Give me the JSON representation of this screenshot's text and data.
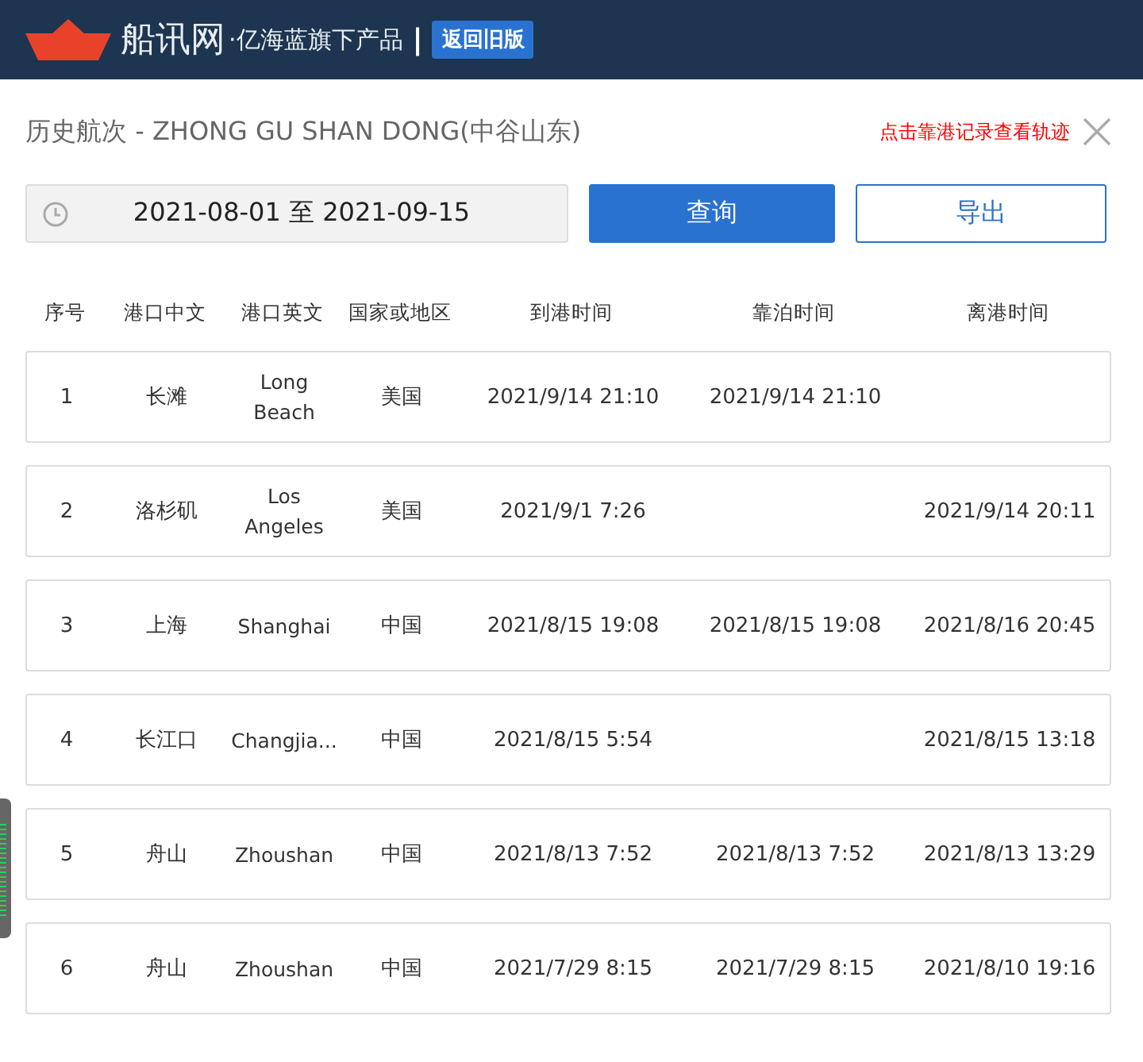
{
  "header": {
    "brand": "船讯网",
    "tagline": "·亿海蓝旗下产品",
    "divider": "|",
    "old_version_button": "返回旧版"
  },
  "panel": {
    "title": "历史航次 - ZHONG GU SHAN DONG(中谷山东)",
    "hint": "点击靠港记录查看轨迹",
    "date_range": "2021-08-01 至 2021-09-15",
    "query_button": "查询",
    "export_button": "导出"
  },
  "table": {
    "columns": [
      "序号",
      "港口中文",
      "港口英文",
      "国家或地区",
      "到港时间",
      "靠泊时间",
      "离港时间"
    ],
    "rows": [
      [
        "1",
        "长滩",
        "Long Beach",
        "美国",
        "2021/9/14 21:10",
        "2021/9/14 21:10",
        ""
      ],
      [
        "2",
        "洛杉矶",
        "Los Angeles",
        "美国",
        "2021/9/1 7:26",
        "",
        "2021/9/14 20:11"
      ],
      [
        "3",
        "上海",
        "Shanghai",
        "中国",
        "2021/8/15 19:08",
        "2021/8/15 19:08",
        "2021/8/16 20:45"
      ],
      [
        "4",
        "长江口",
        "Changjia...",
        "中国",
        "2021/8/15 5:54",
        "",
        "2021/8/15 13:18"
      ],
      [
        "5",
        "舟山",
        "Zhoushan",
        "中国",
        "2021/8/13 7:52",
        "2021/8/13 7:52",
        "2021/8/13 13:29"
      ],
      [
        "6",
        "舟山",
        "Zhoushan",
        "中国",
        "2021/7/29 8:15",
        "2021/7/29 8:15",
        "2021/8/10 19:16"
      ]
    ]
  }
}
